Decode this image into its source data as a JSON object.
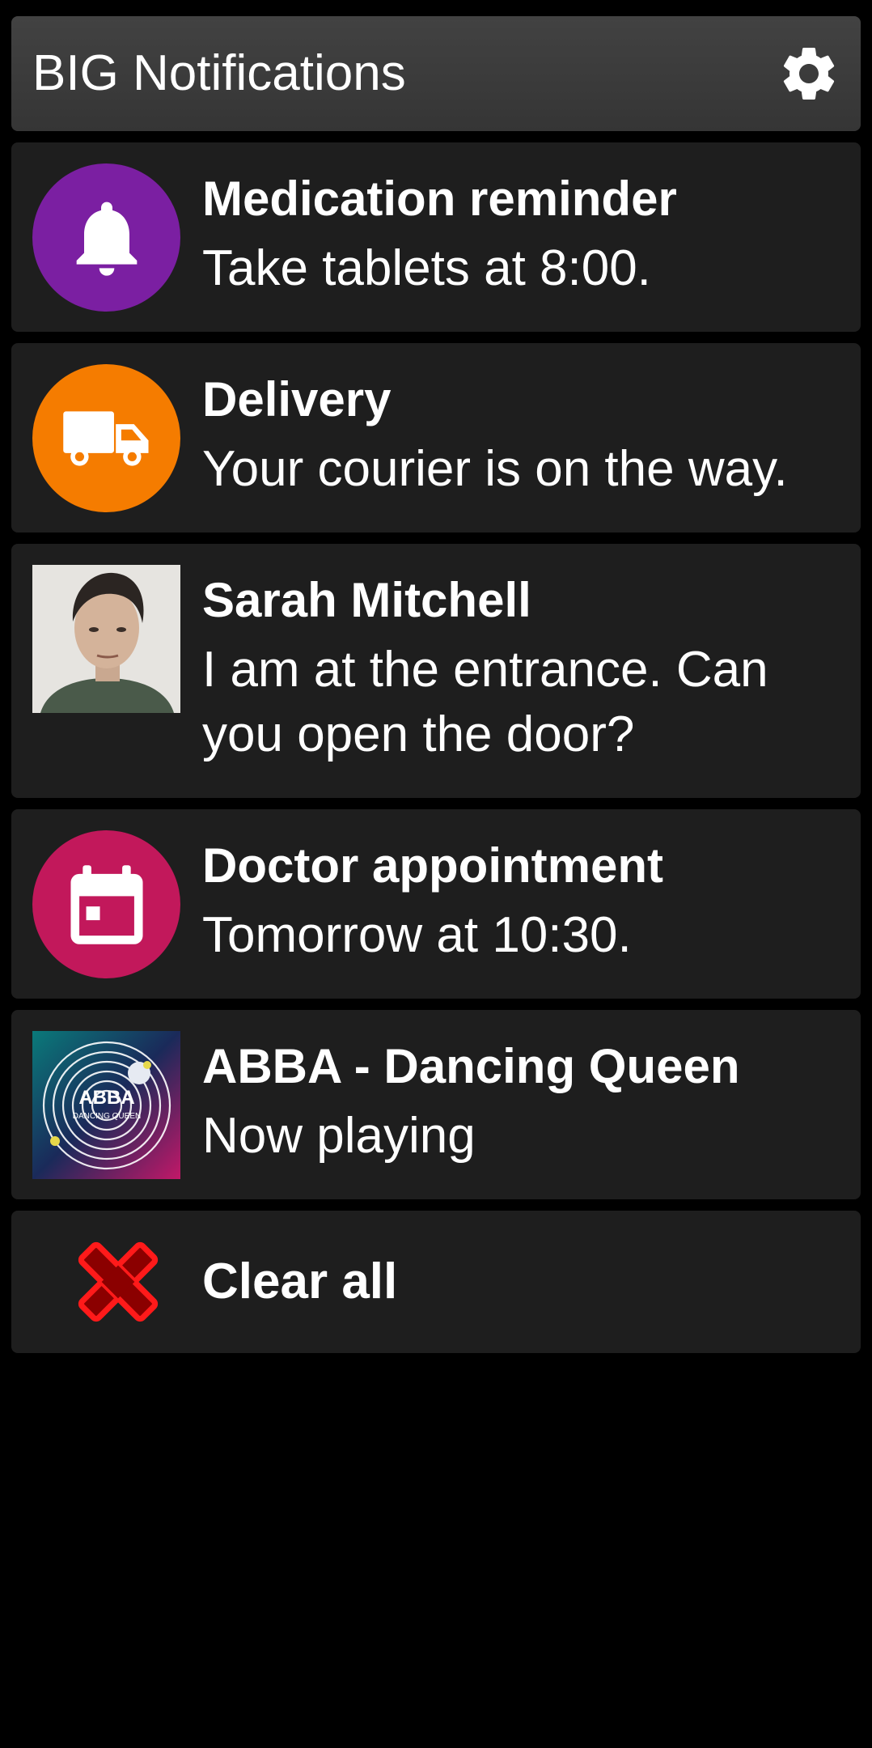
{
  "header": {
    "title": "BIG Notifications",
    "settings_icon": "gear-icon"
  },
  "notifications": [
    {
      "title": "Medication reminder",
      "text": "Take tablets at 8:00.",
      "icon": "bell-icon",
      "color": "#7b1fa2"
    },
    {
      "title": "Delivery",
      "text": "Your courier is on the way.",
      "icon": "truck-icon",
      "color": "#f57c00"
    },
    {
      "title": "Sarah Mitchell",
      "text": "I am at the entrance. Can you open the door?",
      "icon": "avatar"
    },
    {
      "title": "Doctor appointment",
      "text": "Tomorrow at 10:30.",
      "icon": "calendar-icon",
      "color": "#c2185b"
    },
    {
      "title": "ABBA - Dancing Queen",
      "text": "Now playing",
      "icon": "album-art",
      "album_art_text": [
        "ABBA",
        "DANCING QUEEN"
      ]
    }
  ],
  "clear_all": {
    "label": "Clear all",
    "icon": "close-icon",
    "color": "#e00000"
  }
}
